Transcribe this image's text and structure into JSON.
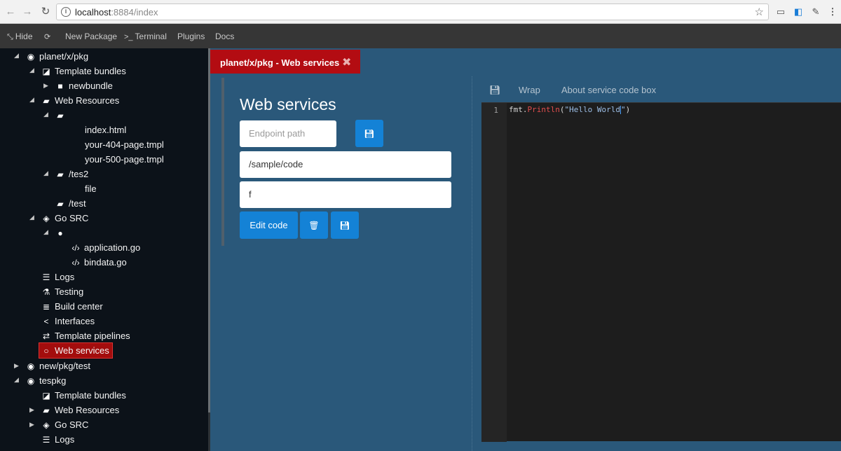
{
  "browser": {
    "url_host": "localhost",
    "url_path": ":8884/index"
  },
  "toolbar": {
    "hide_label": "Hide",
    "new_package_label": "New Package",
    "terminal_label": "Terminal",
    "plugins_label": "Plugins",
    "docs_label": "Docs"
  },
  "sidebar": {
    "rows": [
      {
        "label": "planet/x/pkg"
      },
      {
        "label": "Template bundles"
      },
      {
        "label": "newbundle"
      },
      {
        "label": "Web Resources"
      },
      {
        "label": ""
      },
      {
        "label": "index.html"
      },
      {
        "label": "your-404-page.tmpl"
      },
      {
        "label": "your-500-page.tmpl"
      },
      {
        "label": "/tes2"
      },
      {
        "label": "file"
      },
      {
        "label": "/test"
      },
      {
        "label": "Go SRC"
      },
      {
        "label": ""
      },
      {
        "label": "application.go"
      },
      {
        "label": "bindata.go"
      },
      {
        "label": "Logs"
      },
      {
        "label": "Testing"
      },
      {
        "label": "Build center"
      },
      {
        "label": "Interfaces"
      },
      {
        "label": "Template pipelines"
      },
      {
        "label": "Web services"
      },
      {
        "label": "new/pkg/test"
      },
      {
        "label": "tespkg"
      },
      {
        "label": "Template bundles"
      },
      {
        "label": "Web Resources"
      },
      {
        "label": "Go SRC"
      },
      {
        "label": "Logs"
      }
    ]
  },
  "tab": {
    "label": "planet/x/pkg - Web services",
    "close_glyph": "✖"
  },
  "web_services": {
    "title": "Web services",
    "endpoint_placeholder": "Endpoint path",
    "path_value": "/sample/code",
    "method_value": "f",
    "edit_code_label": "Edit code"
  },
  "editor": {
    "wrap_label": "Wrap",
    "about_label": "About service code box",
    "line_number": "1",
    "code": {
      "ident": "fmt.",
      "func": "Println",
      "open": "(",
      "string_a": "\"Hello World",
      "string_b": "\"",
      "close": ")"
    }
  },
  "colors": {
    "sidebar_bg": "#0c1219",
    "main_bg": "#2a587a",
    "tab_active": "#b30c12",
    "button_blue": "#1482d6",
    "selected_item": "#a30d0d"
  }
}
